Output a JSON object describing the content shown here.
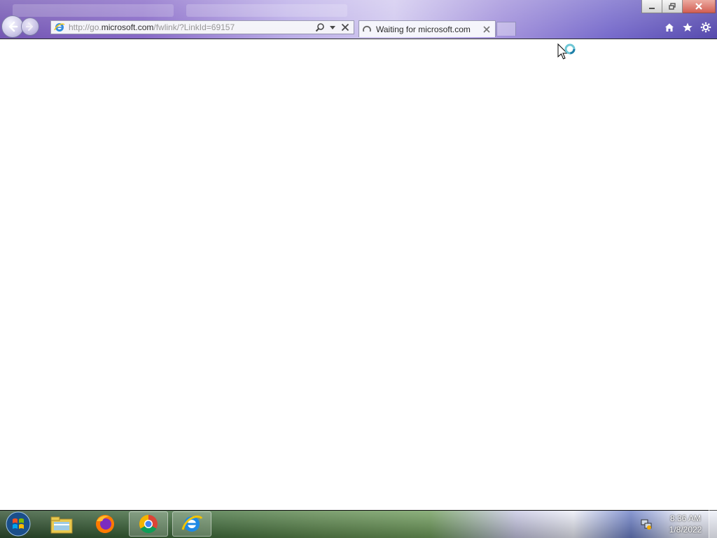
{
  "browser": {
    "address": {
      "prefix": "http://go.",
      "host": "microsoft.com",
      "path": "/fwlink/?LinkId=69157"
    },
    "tab": {
      "title": "Waiting for microsoft.com"
    },
    "icons": {
      "back": "back-arrow-icon",
      "forward": "forward-arrow-icon",
      "site": "ie-page-icon",
      "search": "search-icon",
      "dropdown": "chevron-down-icon",
      "stop": "close-icon",
      "home": "home-icon",
      "favorites": "star-icon",
      "tools": "gear-icon"
    }
  },
  "taskbar": {
    "apps": [
      {
        "name": "Windows Explorer"
      },
      {
        "name": "Firefox"
      },
      {
        "name": "Google Chrome"
      },
      {
        "name": "Internet Explorer"
      }
    ],
    "clock": {
      "time": "8:36 AM",
      "date": "1/8/2022"
    }
  },
  "colors": {
    "accent": "#6b4cae",
    "taskbar": "#3d6b3a"
  }
}
